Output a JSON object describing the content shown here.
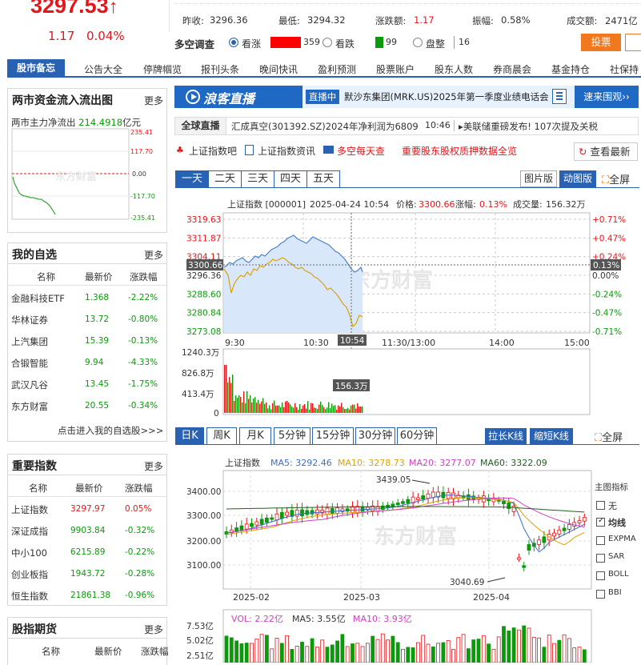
{
  "quote": {
    "price": "3297.53",
    "arrow": "↑",
    "change": "1.17",
    "change_pct": "0.04%",
    "prev_close_label": "昨收:",
    "prev_close": "3296.36",
    "low_label": "最低:",
    "low": "3294.32",
    "chg_amount_label": "涨跌额:",
    "chg_amount": "1.17",
    "amplitude_label": "振幅:",
    "amplitude": "0.58%",
    "amount_label": "成交额:",
    "amount": "2471亿"
  },
  "poll": {
    "title": "多空调查",
    "bull_label": "看涨",
    "bull_count": "359",
    "bear_label": "看跌",
    "bear_count": "99",
    "flat_label": "盘整",
    "flat_count": "16",
    "vote_button": "投票",
    "colors": {
      "bull": "#ff0000",
      "bear": "#0a9a0a"
    }
  },
  "nav": {
    "active": "股市备忘",
    "items": [
      "公告大全",
      "停牌帼览",
      "报刊头条",
      "晚间快讯",
      "盈利预测",
      "股票账户",
      "股东人数",
      "券商晨会",
      "基金持仓",
      "社保持"
    ]
  },
  "flow": {
    "title": "两市资金流入流出图",
    "more": "更多",
    "net_label": "两市主力净流出",
    "net_value": "214.4918",
    "net_unit": "亿元",
    "ticks": [
      "235.41",
      "117.70",
      "0.00",
      "-117.70",
      "-235.41"
    ],
    "watermark": "东方财富"
  },
  "watchlist": {
    "title": "我的自选",
    "more": "更多",
    "headers": [
      "名称",
      "最新价",
      "涨跌幅"
    ],
    "rows": [
      {
        "name": "金融科技ETF",
        "price": "1.368",
        "pct": "-2.22%"
      },
      {
        "name": "华林证券",
        "price": "13.72",
        "pct": "-0.80%"
      },
      {
        "name": "上汽集团",
        "price": "15.39",
        "pct": "-0.13%"
      },
      {
        "name": "合锻智能",
        "price": "9.94",
        "pct": "-4.33%"
      },
      {
        "name": "武汉凡谷",
        "price": "13.45",
        "pct": "-1.75%"
      },
      {
        "name": "东方财富",
        "price": "20.55",
        "pct": "-0.34%"
      }
    ],
    "footer": "点击进入我的自选股>>>"
  },
  "indices": {
    "title": "重要指数",
    "more": "更多",
    "headers": [
      "名称",
      "最新价",
      "涨跌幅"
    ],
    "rows": [
      {
        "name": "上证指数",
        "price": "3297.97",
        "pct": "0.05%"
      },
      {
        "name": "深证成指",
        "price": "9903.84",
        "pct": "-0.32%"
      },
      {
        "name": "中小100",
        "price": "6215.89",
        "pct": "-0.22%"
      },
      {
        "name": "创业板指",
        "price": "1943.72",
        "pct": "-0.28%"
      },
      {
        "name": "恒生指数",
        "price": "21861.38",
        "pct": "-0.96%"
      }
    ]
  },
  "futures": {
    "title": "股指期货",
    "more": "更多",
    "headers": [
      "名称",
      "最新价",
      "涨跌幅"
    ]
  },
  "live": {
    "logo": "浪客直播",
    "badge": "直播中",
    "headline": "默沙东集团(MRK.US)2025年第一季度业绩电话会",
    "button": "速来围观››",
    "ticker_label": "全球直播",
    "ticker_text": "汇成真空(301392.SZ)2024年净利润为6809",
    "ticker_time": "10:46",
    "ticker_news": "美联储重磅发布! 107次提及关税",
    "links": [
      "上证指数吧",
      "上证指数资讯",
      "多空每天查"
    ],
    "promo": "重要股东股权质押数据全览",
    "refresh": "查看最新"
  },
  "intraday": {
    "tabs": [
      "一天",
      "二天",
      "三天",
      "四天",
      "五天"
    ],
    "btn_image": "图片版",
    "btn_anim": "动图版",
    "fullscreen": "全屏",
    "info_name": "上证指数 [000001]",
    "info_time": "2025-04-24 10:54",
    "info_price_label": "价格:",
    "info_price": "3300.66",
    "info_chg_label": "涨幅:",
    "info_chg": "0.13%",
    "info_vol_label": "成交量:",
    "info_vol": "156.32万",
    "y_left": [
      "3319.63",
      "3311.87",
      "3304.11",
      "3296.36",
      "3288.60",
      "3280.84",
      "3273.08"
    ],
    "y_right": [
      "+0.71%",
      "+0.47%",
      "+0.24%",
      "0.00%",
      "-0.24%",
      "-0.47%",
      "-0.71%"
    ],
    "cursor_price": "3300.66",
    "cursor_pct": "0.13%",
    "x_labels": [
      "9:30",
      "10:30",
      "11:30/13:00",
      "14:00",
      "15:00"
    ],
    "cursor_time": "10:54",
    "vol_ticks": [
      "1240.3万",
      "826.8万",
      "413.4万",
      "0"
    ],
    "vol_cursor": "156.3万",
    "watermark": "东方财富"
  },
  "kline": {
    "tabs": [
      "日K",
      "周K",
      "月K",
      "5分钟",
      "15分钟",
      "30分钟",
      "60分钟"
    ],
    "btn_stretch": "拉长K线",
    "btn_shrink": "缩短K线",
    "fullscreen": "全屏",
    "legend_name": "上证指数",
    "ma5": "MA5: 3292.46",
    "ma10": "MA10: 3278.73",
    "ma20": "MA20: 3277.07",
    "ma60": "MA60: 3322.09",
    "y_ticks": [
      "3400.00",
      "3300.00",
      "3200.00",
      "3100.00"
    ],
    "x_labels": [
      "2025-02",
      "2025-03",
      "2025-04"
    ],
    "high_mark": "3439.05",
    "low_mark": "3040.69",
    "indicator_title": "主图指标",
    "indicators": [
      "无",
      "均线",
      "EXPMA",
      "SAR",
      "BOLL",
      "BBI"
    ],
    "indicator_checked": "均线",
    "vol_label": "VOL: 2.22亿",
    "vol_ma5": "MA5: 3.55亿",
    "vol_ma10": "MA10: 3.93亿",
    "vol_ticks": [
      "7.53亿",
      "5.02亿",
      "2.51亿"
    ],
    "watermark": "东方财富"
  }
}
